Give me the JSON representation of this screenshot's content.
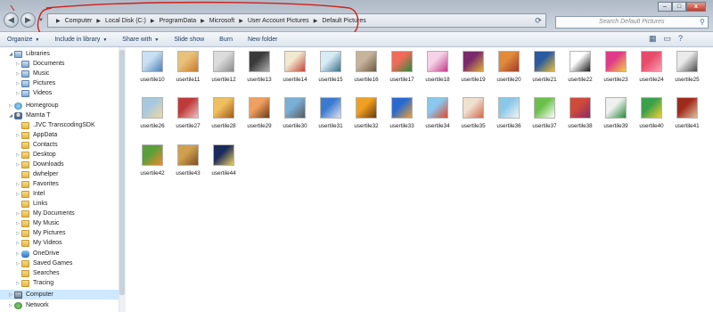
{
  "window": {
    "breadcrumbs": [
      "Computer",
      "Local Disk (C:)",
      "ProgramData",
      "Microsoft",
      "User Account Pictures",
      "Default Pictures"
    ],
    "search_placeholder": "Search Default Pictures",
    "controls": {
      "minimize": "–",
      "maximize": "□",
      "close": "x"
    }
  },
  "toolbar": {
    "items": [
      "Organize",
      "Include in library",
      "Share with",
      "Slide show",
      "Burn",
      "New folder"
    ]
  },
  "sidebar": {
    "items": [
      {
        "label": "Libraries",
        "icon": "library-icon"
      },
      {
        "label": "Documents",
        "icon": "library-icon"
      },
      {
        "label": "Music",
        "icon": "library-icon"
      },
      {
        "label": "Pictures",
        "icon": "library-icon"
      },
      {
        "label": "Videos",
        "icon": "library-icon"
      },
      {
        "label": "Homegroup",
        "icon": "homegroup-icon"
      },
      {
        "label": "Mamta T",
        "icon": "user-icon"
      },
      {
        "label": ".JVC TranscodingSDK",
        "icon": "folder-icon"
      },
      {
        "label": "AppData",
        "icon": "folder-icon"
      },
      {
        "label": "Contacts",
        "icon": "folder-icon"
      },
      {
        "label": "Desktop",
        "icon": "folder-icon"
      },
      {
        "label": "Downloads",
        "icon": "folder-icon"
      },
      {
        "label": "dwhelper",
        "icon": "folder-icon"
      },
      {
        "label": "Favorites",
        "icon": "folder-icon"
      },
      {
        "label": "Intel",
        "icon": "folder-icon"
      },
      {
        "label": "Links",
        "icon": "folder-icon"
      },
      {
        "label": "My Documents",
        "icon": "folder-icon"
      },
      {
        "label": "My Music",
        "icon": "folder-icon"
      },
      {
        "label": "My Pictures",
        "icon": "folder-icon"
      },
      {
        "label": "My Videos",
        "icon": "folder-icon"
      },
      {
        "label": "OneDrive",
        "icon": "onedrive-icon"
      },
      {
        "label": "Saved Games",
        "icon": "folder-icon"
      },
      {
        "label": "Searches",
        "icon": "folder-icon"
      },
      {
        "label": "Tracing",
        "icon": "folder-icon"
      },
      {
        "label": "Computer",
        "icon": "computer-icon"
      },
      {
        "label": "Network",
        "icon": "network-icon"
      }
    ]
  },
  "files": [
    {
      "name": "usertile10",
      "colors": [
        "#c9dff3",
        "#4a7fb5"
      ]
    },
    {
      "name": "usertile11",
      "colors": [
        "#e8c17a",
        "#c97a2a"
      ]
    },
    {
      "name": "usertile12",
      "colors": [
        "#dcdcdc",
        "#8a8a8a"
      ]
    },
    {
      "name": "usertile13",
      "colors": [
        "#3a3a3a",
        "#b0b0b0"
      ]
    },
    {
      "name": "usertile14",
      "colors": [
        "#f3e8d0",
        "#c0463a"
      ]
    },
    {
      "name": "usertile15",
      "colors": [
        "#d8ecf5",
        "#3a6f8a"
      ]
    },
    {
      "name": "usertile16",
      "colors": [
        "#c8b49a",
        "#6a5a44"
      ]
    },
    {
      "name": "usertile17",
      "colors": [
        "#f06a5a",
        "#2a8a3a"
      ]
    },
    {
      "name": "usertile18",
      "colors": [
        "#f5d3e6",
        "#c23a8a"
      ]
    },
    {
      "name": "usertile19",
      "colors": [
        "#7a2a6a",
        "#e0b03a"
      ]
    },
    {
      "name": "usertile20",
      "colors": [
        "#e08a3a",
        "#a03a2a"
      ]
    },
    {
      "name": "usertile21",
      "colors": [
        "#2a5aa0",
        "#f0c030"
      ]
    },
    {
      "name": "usertile22",
      "colors": [
        "#ffffff",
        "#1a1a1a"
      ]
    },
    {
      "name": "usertile23",
      "colors": [
        "#e03a8a",
        "#f0d040"
      ]
    },
    {
      "name": "usertile24",
      "colors": [
        "#e84a6a",
        "#f7a3b3"
      ]
    },
    {
      "name": "usertile25",
      "colors": [
        "#eaeaea",
        "#4a4a4a"
      ]
    },
    {
      "name": "usertile26",
      "colors": [
        "#a8c8e0",
        "#f0d8a0"
      ]
    },
    {
      "name": "usertile27",
      "colors": [
        "#c03a3a",
        "#f0c0c0"
      ]
    },
    {
      "name": "usertile28",
      "colors": [
        "#f0c060",
        "#a05a1a"
      ]
    },
    {
      "name": "usertile29",
      "colors": [
        "#f0a060",
        "#6a3a1a"
      ]
    },
    {
      "name": "usertile30",
      "colors": [
        "#7ab0d8",
        "#5a5a5a"
      ]
    },
    {
      "name": "usertile31",
      "colors": [
        "#3a7ad0",
        "#e0e0f0"
      ]
    },
    {
      "name": "usertile32",
      "colors": [
        "#f0a020",
        "#6a3a10"
      ]
    },
    {
      "name": "usertile33",
      "colors": [
        "#2a6ad0",
        "#f0a030"
      ]
    },
    {
      "name": "usertile34",
      "colors": [
        "#8ac8f0",
        "#e04a2a"
      ]
    },
    {
      "name": "usertile35",
      "colors": [
        "#f0e0d0",
        "#d06a4a"
      ]
    },
    {
      "name": "usertile36",
      "colors": [
        "#8ac8e8",
        "#f5f5f5"
      ]
    },
    {
      "name": "usertile37",
      "colors": [
        "#6ac04a",
        "#ffffff"
      ]
    },
    {
      "name": "usertile38",
      "colors": [
        "#d04a3a",
        "#8a2a6a"
      ]
    },
    {
      "name": "usertile39",
      "colors": [
        "#f0f0f0",
        "#2a8a3a"
      ]
    },
    {
      "name": "usertile40",
      "colors": [
        "#3aa04a",
        "#f0d030"
      ]
    },
    {
      "name": "usertile41",
      "colors": [
        "#a02a1a",
        "#e0c0a0"
      ]
    },
    {
      "name": "usertile42",
      "colors": [
        "#5aa03a",
        "#f08a2a"
      ]
    },
    {
      "name": "usertile43",
      "colors": [
        "#d0a050",
        "#7a5020"
      ]
    },
    {
      "name": "usertile44",
      "colors": [
        "#1a2a5a",
        "#f0d060"
      ]
    }
  ]
}
